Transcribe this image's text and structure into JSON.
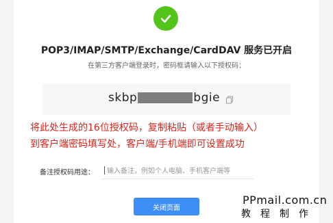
{
  "status": {
    "title": "POP3/IMAP/SMTP/Exchange/CardDAV 服务已开启",
    "subtitle": "在第三方客户端登录时，密码框请输入以下授权码："
  },
  "auth_code": {
    "prefix": "skbp",
    "suffix": "bgie",
    "copy_icon": "copy-icon"
  },
  "annotation": {
    "line1": "将此处生成的16位授权码，复制粘贴（或者手动输入）",
    "line2": "到客户端密码填写处，客户端/手机端即可设置成功"
  },
  "note": {
    "label": "备注授权码用途：",
    "placeholder": "输入备注，例如个人电脑、手机客户端等"
  },
  "close_button": {
    "label": "关闭页面"
  },
  "watermark": {
    "line1": "PPmail.com.cn",
    "line2": "教程制作"
  },
  "colors": {
    "success": "#52c41a",
    "annotation": "#d9261c",
    "primary_button": "#3d8ef6"
  }
}
